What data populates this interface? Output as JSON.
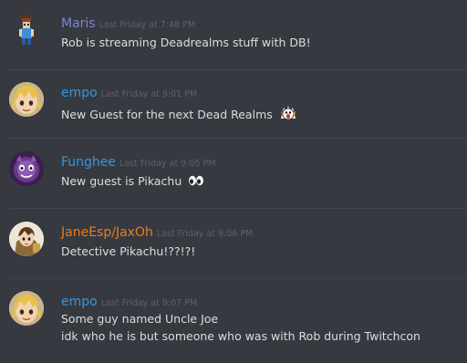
{
  "messages": [
    {
      "author": "Maris",
      "author_color": "#7b84d4",
      "timestamp": "Last Friday at 7:48 PM",
      "lines": [
        "Rob is streaming Deadrealms stuff with DB!"
      ],
      "avatar_icon": "character-sprite-avatar"
    },
    {
      "author": "empo",
      "author_color": "#3498db",
      "timestamp": "Last Friday at 9:01 PM",
      "lines": [
        "New Guest for the next Dead Realms"
      ],
      "trailing_emoji": "screaming-face-emoji",
      "avatar_icon": "blonde-character-avatar"
    },
    {
      "author": "Funghee",
      "author_color": "#3498db",
      "timestamp": "Last Friday at 9:05 PM",
      "lines": [
        "New guest is Pikachu"
      ],
      "trailing_emoji": "eyes-emoji",
      "avatar_icon": "purple-creature-avatar"
    },
    {
      "author": "JaneEsp/JaxOh",
      "author_color": "#e67e22",
      "timestamp": "Last Friday at 9:06 PM",
      "lines": [
        "Detective Pikachu!??!?!"
      ],
      "avatar_icon": "anime-character-avatar"
    },
    {
      "author": "empo",
      "author_color": "#3498db",
      "timestamp": "Last Friday at 9:07 PM",
      "lines": [
        "Some guy named Uncle Joe",
        "idk who he is but someone who was with Rob during Twitchcon"
      ],
      "avatar_icon": "blonde-character-avatar"
    }
  ]
}
